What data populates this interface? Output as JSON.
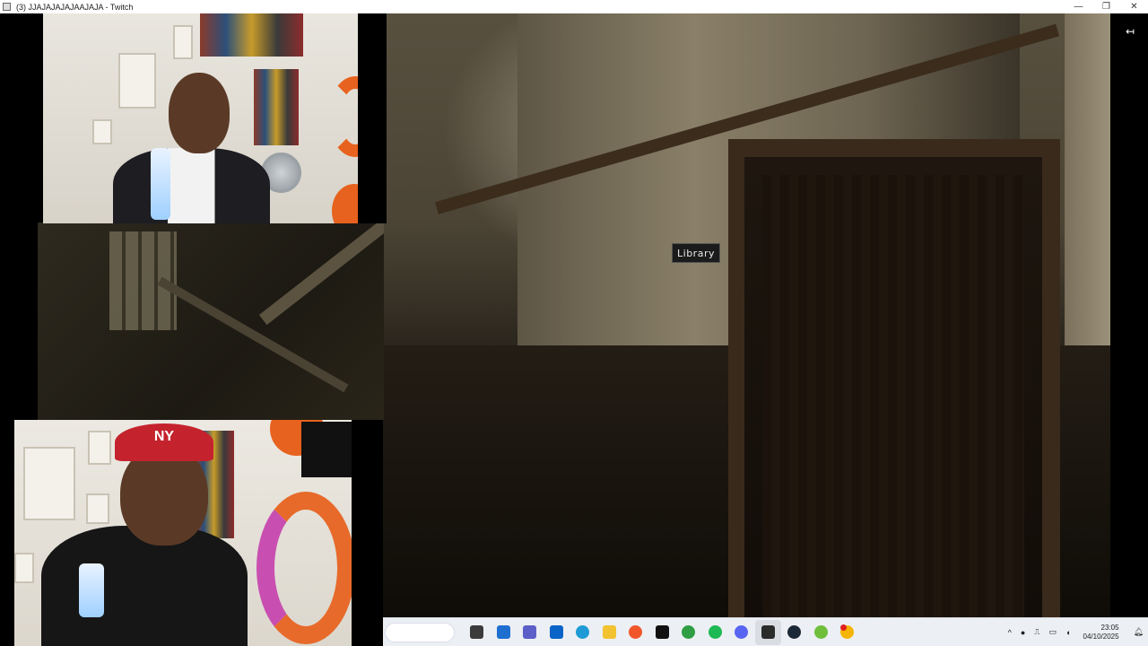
{
  "window": {
    "title": "(3) JJAJAJAJAJAAJAJA - Twitch",
    "controls": {
      "minimize": "—",
      "maximize": "❐",
      "close": "✕"
    }
  },
  "player": {
    "exit_icon": "exit-fullscreen-icon",
    "exit_glyph": "↤"
  },
  "game_scene": {
    "sign_text": "Library"
  },
  "webcams": {
    "top": {
      "cap_logo": ""
    },
    "bottom": {
      "cap_logo": "NY"
    }
  },
  "taskbar": {
    "apps": [
      {
        "name": "task-view-icon",
        "color": "#3b3b3b"
      },
      {
        "name": "microsoft-store-icon",
        "color": "#1f6fd1"
      },
      {
        "name": "teams-icon",
        "color": "#5b5fc7"
      },
      {
        "name": "outlook-icon",
        "color": "#0a64c8"
      },
      {
        "name": "edge-icon",
        "color": "#1e9bd7"
      },
      {
        "name": "file-explorer-icon",
        "color": "#f2c230"
      },
      {
        "name": "brave-icon",
        "color": "#f1562a"
      },
      {
        "name": "tiktok-icon",
        "color": "#111111"
      },
      {
        "name": "chrome-icon",
        "color": "#2f9e44"
      },
      {
        "name": "spotify-icon",
        "color": "#1db954"
      },
      {
        "name": "discord-icon",
        "color": "#5865f2"
      },
      {
        "name": "notes-app-icon",
        "color": "#2b2b2b"
      },
      {
        "name": "steam-icon",
        "color": "#1b2838"
      },
      {
        "name": "utorrent-icon",
        "color": "#6fbf3b"
      },
      {
        "name": "chrome-canary-icon",
        "color": "#f4b400"
      }
    ],
    "tray": {
      "chevron": "^",
      "clock_time": "23:05",
      "clock_date": "04/10/2025"
    }
  }
}
